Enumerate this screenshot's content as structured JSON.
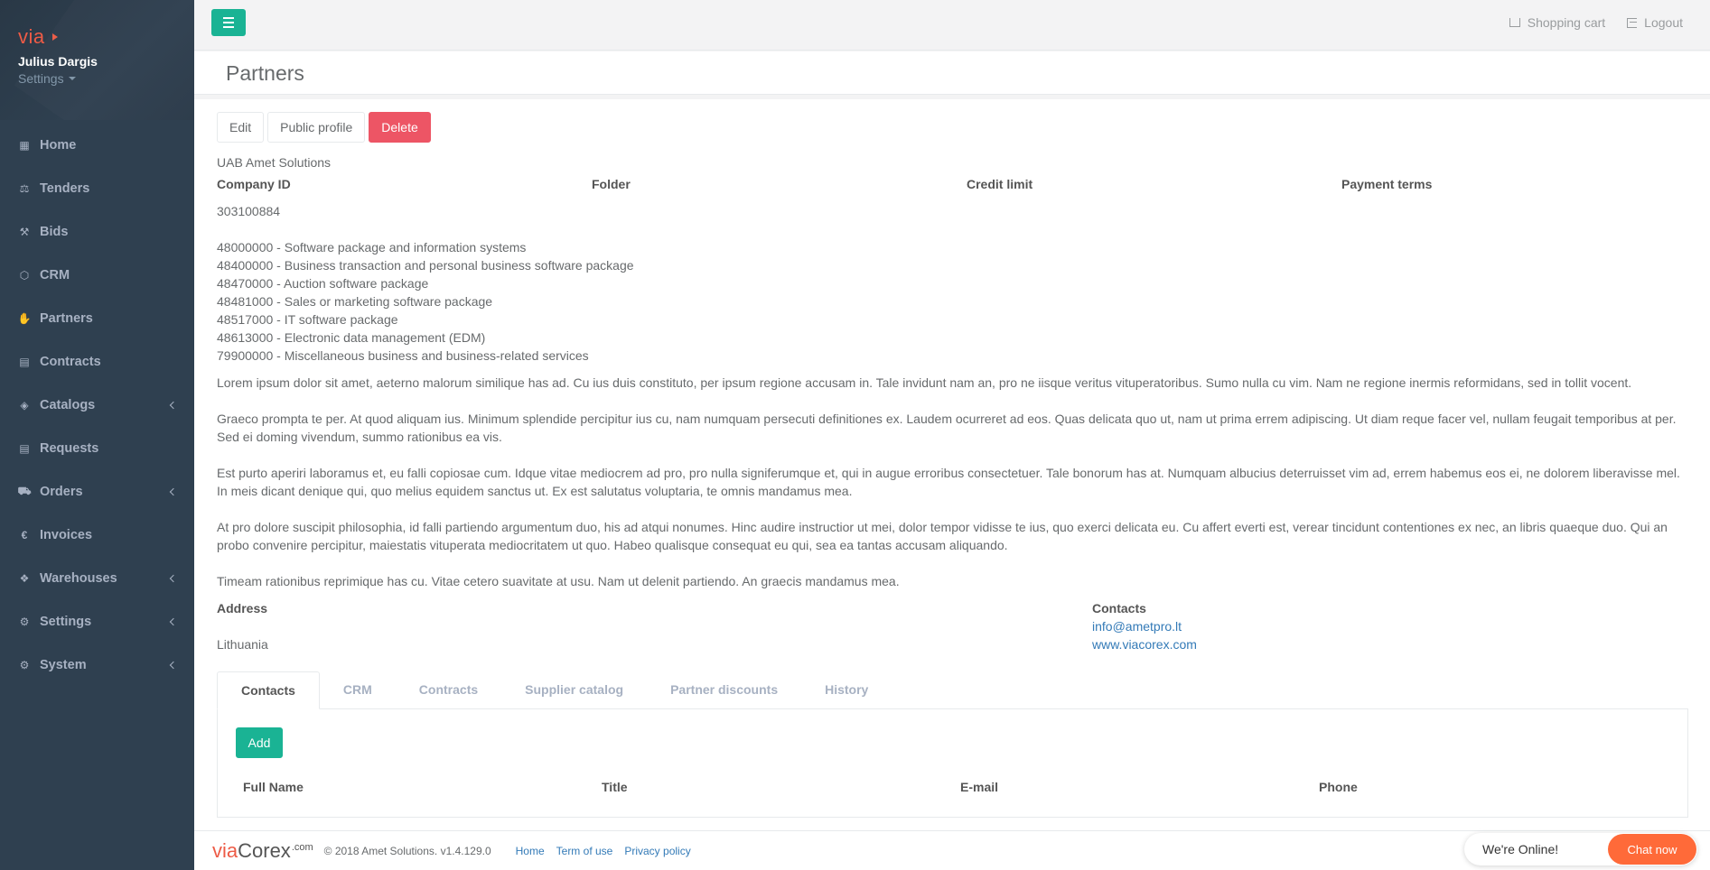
{
  "brand": {
    "logo_text": "via"
  },
  "user": {
    "name": "Julius Dargis",
    "settings_label": "Settings"
  },
  "sidebar": {
    "items": [
      {
        "label": "Home",
        "icon": "th-large-icon",
        "glyph": "▦",
        "has_submenu": false
      },
      {
        "label": "Tenders",
        "icon": "balance-scale-icon",
        "glyph": "⚖",
        "has_submenu": false
      },
      {
        "label": "Bids",
        "icon": "gavel-icon",
        "glyph": "⚒",
        "has_submenu": false
      },
      {
        "label": "CRM",
        "icon": "cubes-icon",
        "glyph": "⬡",
        "has_submenu": false
      },
      {
        "label": "Partners",
        "icon": "handshake-icon",
        "glyph": "✋",
        "has_submenu": false
      },
      {
        "label": "Contracts",
        "icon": "file-text-icon",
        "glyph": "▤",
        "has_submenu": false
      },
      {
        "label": "Catalogs",
        "icon": "tags-icon",
        "glyph": "◈",
        "has_submenu": true
      },
      {
        "label": "Requests",
        "icon": "file-icon",
        "glyph": "▤",
        "has_submenu": false
      },
      {
        "label": "Orders",
        "icon": "shopping-cart-icon",
        "glyph": "⛟",
        "has_submenu": true
      },
      {
        "label": "Invoices",
        "icon": "euro-icon",
        "glyph": "€",
        "has_submenu": false
      },
      {
        "label": "Warehouses",
        "icon": "cubes-icon",
        "glyph": "❖",
        "has_submenu": true
      },
      {
        "label": "Settings",
        "icon": "cogs-icon",
        "glyph": "⚙",
        "has_submenu": true
      },
      {
        "label": "System",
        "icon": "cogs-icon",
        "glyph": "⚙",
        "has_submenu": true
      }
    ]
  },
  "topbar": {
    "cart_label": "Shopping cart",
    "logout_label": "Logout"
  },
  "page": {
    "title": "Partners"
  },
  "actions": {
    "edit": "Edit",
    "public_profile": "Public profile",
    "delete": "Delete"
  },
  "company": {
    "name": "UAB Amet Solutions",
    "headers": {
      "company_id": "Company ID",
      "folder": "Folder",
      "credit_limit": "Credit limit",
      "payment_terms": "Payment terms"
    },
    "company_id": "303100884",
    "cpv_codes": [
      "48000000 - Software package and information systems",
      "48400000 - Business transaction and personal business software package",
      "48470000 - Auction software package",
      "48481000 - Sales or marketing software package",
      "48517000 - IT software package",
      "48613000 - Electronic data management (EDM)",
      "79900000 - Miscellaneous business and business-related services"
    ],
    "description": [
      "Lorem ipsum dolor sit amet, aeterno malorum similique has ad. Cu ius duis constituto, per ipsum regione accusam in. Tale invidunt nam an, pro ne iisque veritus vituperatoribus. Sumo nulla cu vim. Nam ne regione inermis reformidans, sed in tollit vocent.",
      "Graeco prompta te per. At quod aliquam ius. Minimum splendide percipitur ius cu, nam numquam persecuti definitiones ex. Laudem ocurreret ad eos. Quas delicata quo ut, nam ut prima errem adipiscing. Ut diam reque facer vel, nullam feugait temporibus at per. Sed ei doming vivendum, summo rationibus ea vis.",
      "Est purto aperiri laboramus et, eu falli copiosae cum. Idque vitae mediocrem ad pro, pro nulla signiferumque et, qui in augue erroribus consectetuer. Tale bonorum has at. Numquam albucius deterruisset vim ad, errem habemus eos ei, ne dolorem liberavisse mel. In meis dicant denique qui, quo melius equidem sanctus ut. Ex est salutatus voluptaria, te omnis mandamus mea.",
      "At pro dolore suscipit philosophia, id falli partiendo argumentum duo, his ad atqui nonumes. Hinc audire instructior ut mei, dolor tempor vidisse te ius, quo exerci delicata eu. Cu affert everti est, verear tincidunt contentiones ex nec, an libris quaeque duo. Qui an probo convenire percipitur, maiestatis vituperata mediocritatem ut quo. Habeo qualisque consequat eu qui, sea ea tantas accusam aliquando.",
      "Timeam rationibus reprimique has cu. Vitae cetero suavitate at usu. Nam ut delenit partiendo. An graecis mandamus mea."
    ],
    "address_label": "Address",
    "address": "Lithuania",
    "contacts_label": "Contacts",
    "email": "info@ametpro.lt",
    "website": "www.viacorex.com"
  },
  "tabs": [
    "Contacts",
    "CRM",
    "Contracts",
    "Supplier catalog",
    "Partner discounts",
    "History"
  ],
  "contacts_panel": {
    "add_label": "Add",
    "columns": [
      "Full Name",
      "Title",
      "E-mail",
      "Phone"
    ]
  },
  "footer": {
    "logo_via": "via",
    "logo_corex": "Corex",
    "logo_com": ".com",
    "copyright": "© 2018 Amet Solutions. v1.4.129.0",
    "links": [
      "Home",
      "Term of use",
      "Privacy policy"
    ]
  },
  "chat": {
    "status": "We're Online!",
    "button": "Chat now"
  },
  "colors": {
    "sidebar": "#2f4050",
    "primary": "#1ab394",
    "danger": "#ed5565",
    "chat": "#ff6a39",
    "brand": "#ed5b46"
  }
}
